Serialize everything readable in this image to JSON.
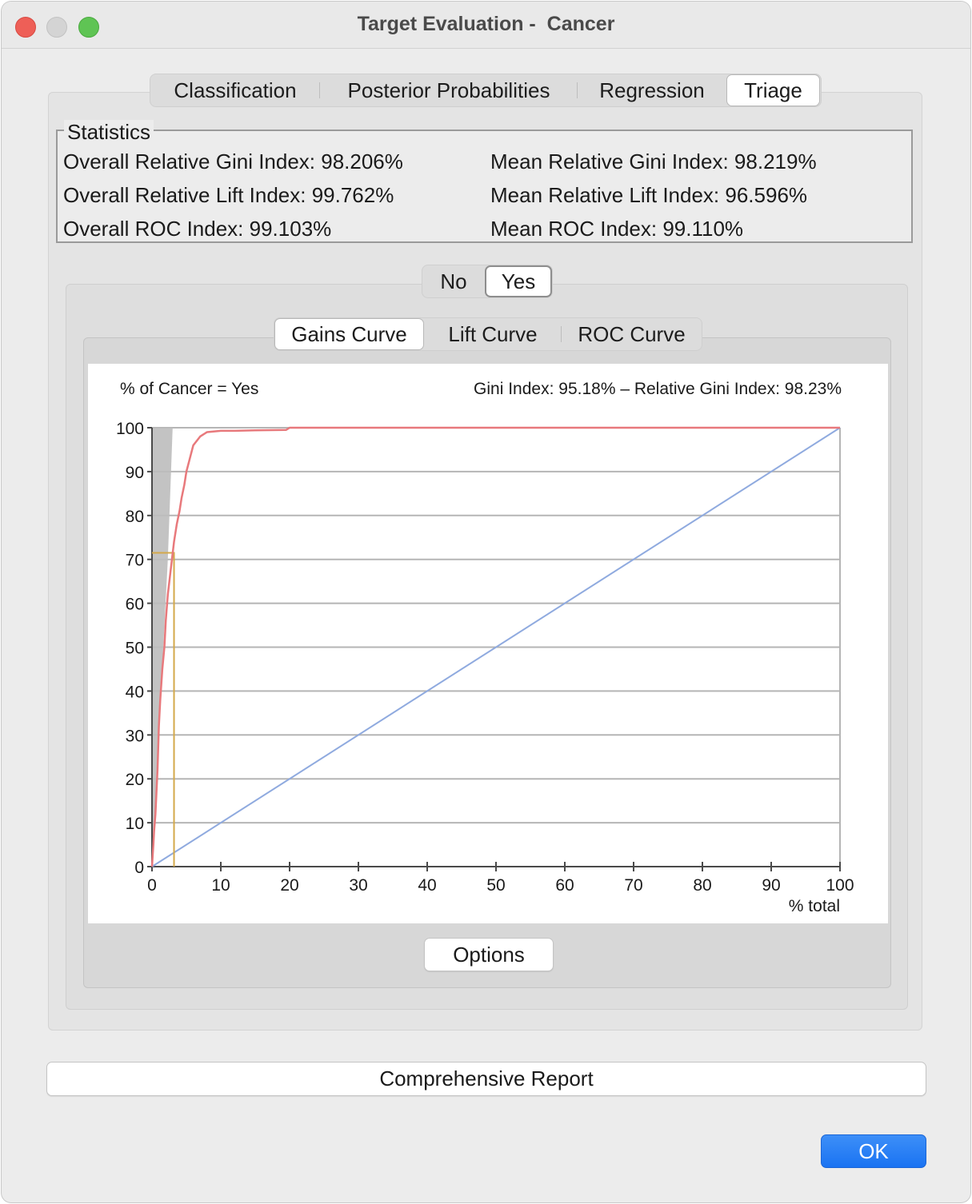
{
  "window": {
    "title": "Target Evaluation -  Cancer"
  },
  "tabs": [
    "Classification",
    "Posterior Probabilities",
    "Regression",
    "Triage"
  ],
  "active_tab": "Triage",
  "statistics": {
    "group_title": "Statistics",
    "overall_gini": "Overall Relative Gini Index: 98.206%",
    "overall_lift": "Overall Relative Lift Index: 99.762%",
    "overall_roc": "Overall ROC Index: 99.103%",
    "mean_gini": "Mean Relative Gini Index: 98.219%",
    "mean_lift": "Mean Relative Lift Index: 96.596%",
    "mean_roc": "Mean ROC Index: 99.110%"
  },
  "class_toggle": {
    "options": [
      "No",
      "Yes"
    ],
    "selected": "Yes"
  },
  "curve_tabs": {
    "options": [
      "Gains Curve",
      "Lift Curve",
      "ROC Curve"
    ],
    "selected": "Gains Curve"
  },
  "buttons": {
    "options": "Options",
    "report": "Comprehensive Report",
    "ok": "OK"
  },
  "colors": {
    "gains_curve": "#e8797c",
    "baseline": "#8faadf",
    "threshold": "#d4a94a",
    "ideal_area": "#bdbdbd",
    "ok_button": "#1a73f2"
  },
  "chart_data": {
    "type": "line",
    "title": "Gini Index: 95.18% – Relative Gini Index: 98.23%",
    "ylabel": "% of Cancer = Yes",
    "xlabel": "% total",
    "xlim": [
      0,
      100
    ],
    "ylim": [
      0,
      100
    ],
    "x_ticks": [
      0,
      10,
      20,
      30,
      40,
      50,
      60,
      70,
      80,
      90,
      100
    ],
    "y_ticks": [
      0,
      10,
      20,
      30,
      40,
      50,
      60,
      70,
      80,
      90,
      100
    ],
    "grid": true,
    "series": [
      {
        "role": "model",
        "x": [
          0,
          0.2,
          0.3,
          0.5,
          0.8,
          1.0,
          1.2,
          1.5,
          1.8,
          2.0,
          2.3,
          2.6,
          2.9,
          3.2,
          3.6,
          4.0,
          4.3,
          4.7,
          5.0,
          5.5,
          6.0,
          7.0,
          8.0,
          10.0,
          12.0,
          15.0,
          19.5,
          20.0,
          100.0
        ],
        "y": [
          0,
          5,
          8,
          12,
          22,
          32,
          38,
          45,
          50,
          56,
          62,
          66,
          70,
          74,
          78,
          81,
          84,
          87,
          90,
          93,
          96,
          98,
          99,
          99.3,
          99.3,
          99.4,
          99.5,
          100,
          100
        ]
      },
      {
        "role": "baseline",
        "x": [
          0,
          100
        ],
        "y": [
          0,
          100
        ]
      }
    ],
    "threshold": {
      "x": 3.2,
      "y": 71.5
    }
  }
}
